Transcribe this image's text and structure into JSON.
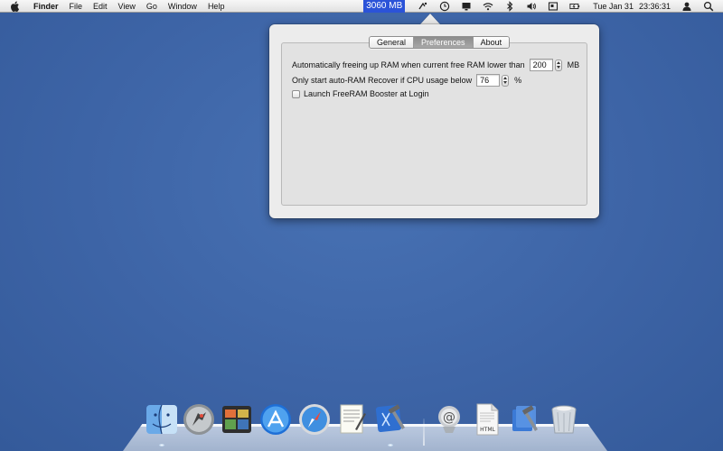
{
  "menubar": {
    "app_name": "Finder",
    "menus": [
      "File",
      "Edit",
      "View",
      "Go",
      "Window",
      "Help"
    ],
    "ram_status": "3060 MB",
    "status_icons": [
      "timemachine-icon",
      "bluetooth-icon",
      "clock-icon",
      "display-icon",
      "wifi-icon",
      "bluetooth-alt-icon",
      "volume-icon",
      "input-icon",
      "battery-icon"
    ],
    "clock_day": "Tue Jan 31",
    "clock_time": "23:36:31"
  },
  "popover": {
    "tabs": [
      "General",
      "Preferences",
      "About"
    ],
    "selected_tab": "Preferences",
    "preferences": {
      "free_ram_label": "Automatically freeing up RAM when current free RAM lower than",
      "free_ram_value": "200",
      "free_ram_unit": "MB",
      "cpu_label": "Only start auto-RAM Recover if CPU usage below",
      "cpu_value": "76",
      "cpu_unit": "%",
      "login_label": "Launch FreeRAM Booster at Login",
      "login_checked": false
    }
  },
  "dock": {
    "html_doc_label": "HTML",
    "apps": [
      "finder-icon",
      "launchpad-icon",
      "photo-booth-icon",
      "app-store-icon",
      "safari-icon",
      "textedit-icon",
      "xcode-icon",
      "mail-icon",
      "html-document-icon",
      "xcode-doc-icon",
      "trash-icon"
    ]
  },
  "colors": {
    "desktop": "#3d64a6",
    "ram_highlight": "#2b53d8",
    "popover_bg": "#ececec"
  }
}
